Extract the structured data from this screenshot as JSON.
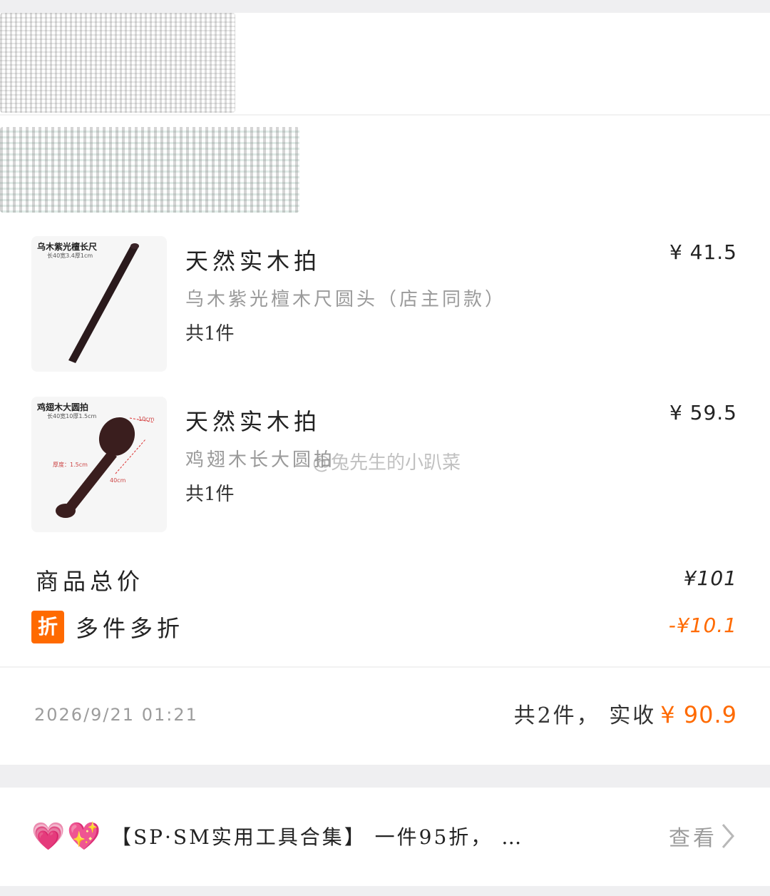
{
  "items": [
    {
      "thumb_title": "乌木紫光檀长尺",
      "thumb_sub": "长40宽3.4厚1cm",
      "name": "天然实木拍",
      "spec": "乌木紫光檀木尺圆头（店主同款）",
      "qty": "共1件",
      "price": "¥ 41.5"
    },
    {
      "thumb_title": "鸡翅木大圆拍",
      "thumb_sub": "长40宽10厚1.5cm",
      "thumb_labels": [
        "10cm",
        "厚度：1.5cm",
        "40cm"
      ],
      "name": "天然实木拍",
      "spec": "鸡翅木长大圆拍",
      "qty": "共1件",
      "price": "¥ 59.5"
    }
  ],
  "summary": {
    "total_label": "商品总价",
    "total_value": "¥101",
    "discount_badge": "折",
    "discount_label": "多件多折",
    "discount_value": "-¥10.1"
  },
  "order": {
    "time": "2026/9/21 01:21",
    "summary_prefix": "共2件， 实收",
    "amount": "¥ 90.9"
  },
  "promo": {
    "heart_1": "💗",
    "heart_2": "💖",
    "text": "【SP·SM实用工具合集】 一件95折， …",
    "view_label": "查看"
  },
  "watermark": "@兔先生的小趴菜",
  "colors": {
    "accent": "#ff6a00",
    "muted": "#9c9c9c"
  }
}
